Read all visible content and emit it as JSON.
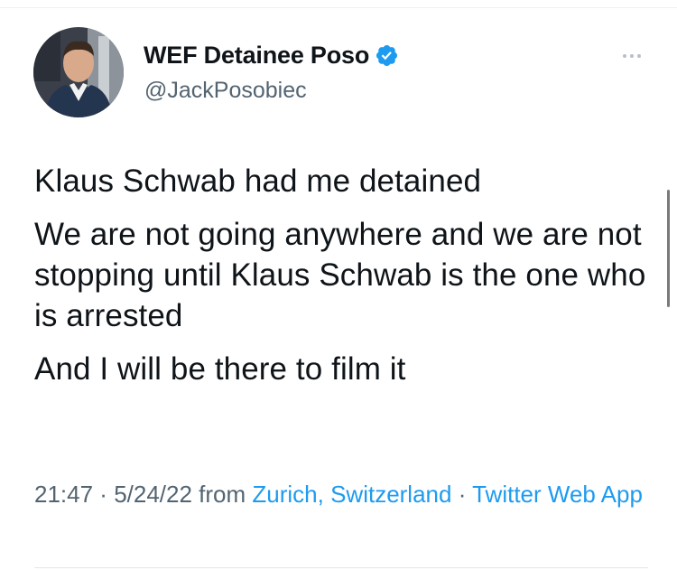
{
  "author": {
    "display_name": "WEF Detainee Poso",
    "handle": "@JackPosobiec",
    "verified": true
  },
  "tweet": {
    "paragraphs": [
      "Klaus Schwab had me detained",
      "We are not going anywhere and we are not stopping until Klaus Schwab is the one who is arrested",
      "And I will be there to film it"
    ]
  },
  "meta": {
    "time": "21:47",
    "separator": " · ",
    "date": "5/24/22",
    "from_label": " from ",
    "location": "Zurich, Switzerland",
    "separator2": " · ",
    "source": "Twitter Web App"
  },
  "icons": {
    "verified": "verified-badge-icon",
    "more": "more-horizontal-icon"
  },
  "colors": {
    "link": "#1d9bf0",
    "secondary_text": "#536471",
    "primary_text": "#0f1419"
  }
}
